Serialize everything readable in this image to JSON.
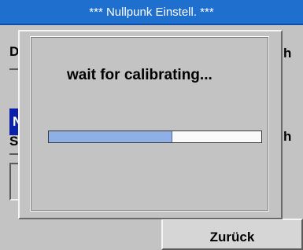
{
  "window": {
    "title": "***   Nullpunk Einstell.  ***"
  },
  "background": {
    "label_du": "Du",
    "label_sel": "Nu",
    "label_sc": "Sc",
    "label_h1": "h",
    "label_h2": "h",
    "back_button": "Zurück"
  },
  "dialog": {
    "message": "wait for calibrating...",
    "progress": 0.58
  }
}
